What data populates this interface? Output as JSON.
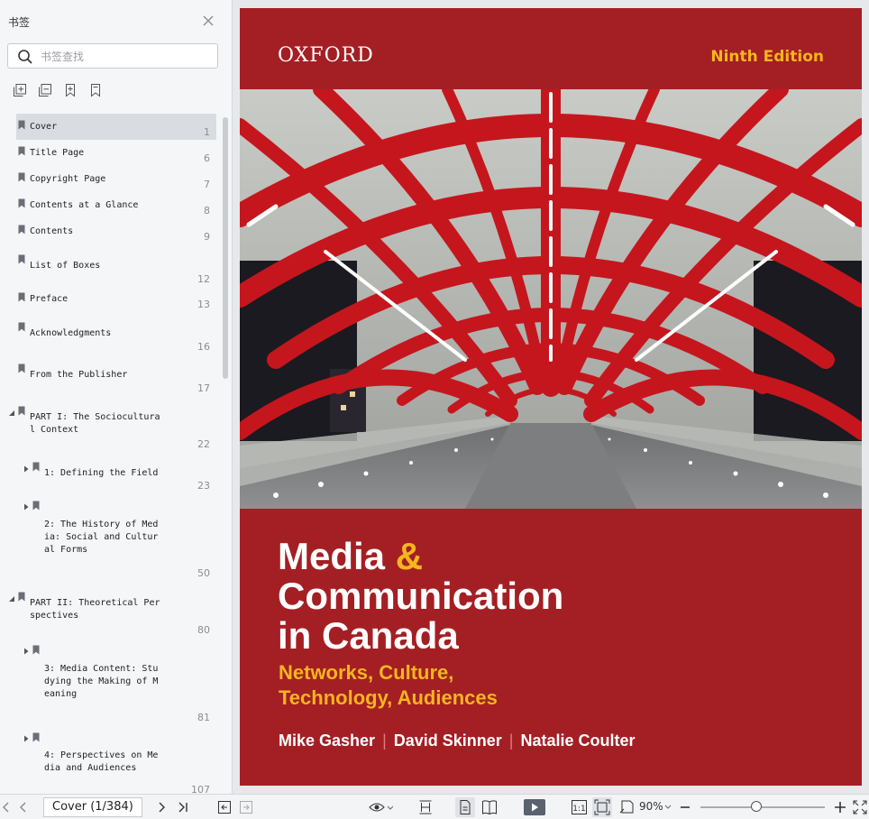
{
  "sidebar": {
    "title": "书签",
    "search_placeholder": "书签查找",
    "bookmarks": [
      {
        "label": "Cover",
        "page": "1"
      },
      {
        "label": "Title Page",
        "page": "6"
      },
      {
        "label": "Copyright Page",
        "page": "7"
      },
      {
        "label": "Contents at a Glance",
        "page": "8"
      },
      {
        "label": "Contents",
        "page": "9"
      },
      {
        "label": "List of Boxes",
        "page": "12"
      },
      {
        "label": "Preface",
        "page": "13"
      },
      {
        "label": "Acknowledgments",
        "page": "16"
      },
      {
        "label": "From the Publisher",
        "page": "17"
      },
      {
        "label": "PART I: The Sociocultura\nl Context",
        "page": "22"
      },
      {
        "label": "1: Defining the Field",
        "page": "23"
      },
      {
        "label": "2: The History of Med\nia: Social and Cultur\nal Forms",
        "page": "50"
      },
      {
        "label": "PART II: Theoretical Per\nspectives",
        "page": "80"
      },
      {
        "label": "3: Media Content: Stu\ndying the Making of M\neaning",
        "page": "81"
      },
      {
        "label": "4: Perspectives on Me\ndia and Audiences",
        "page": "107"
      }
    ]
  },
  "cover": {
    "publisher": "OXFORD",
    "edition": "Ninth Edition",
    "title_line1": "Media",
    "title_amp": "&",
    "title_line2": "Communication",
    "title_line3": "in Canada",
    "subtitle_line1": "Networks, Culture,",
    "subtitle_line2": "Technology, Audiences",
    "author1": "Mike Gasher",
    "author2": "David Skinner",
    "author3": "Natalie Coulter",
    "author_separator": "|"
  },
  "toolbar": {
    "page_indicator": "Cover (1/384)",
    "zoom": "90%",
    "zoom_level_percent": 90
  },
  "colors": {
    "cover_red": "#a41f24",
    "accent_yellow": "#f5b51d",
    "sidebar_bg": "#f5f6f8",
    "selected_bg": "#d9dce1"
  }
}
